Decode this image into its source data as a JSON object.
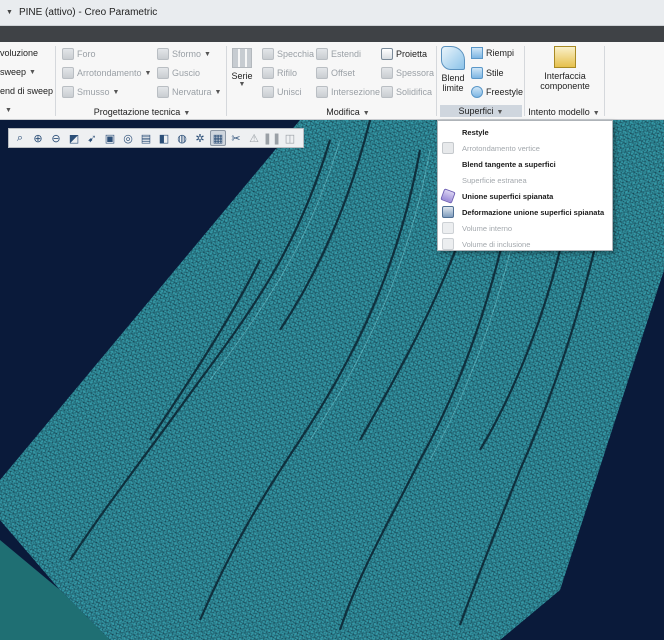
{
  "window": {
    "title": "PINE (attivo) - Creo Parametric"
  },
  "ribbon": {
    "col1": [
      {
        "label": "voluzione"
      },
      {
        "label": "sweep"
      },
      {
        "label": "end di sweep"
      }
    ],
    "engineering": {
      "items": [
        {
          "label": "Foro"
        },
        {
          "label": "Arrotondamento"
        },
        {
          "label": "Smusso"
        },
        {
          "label": "Sformo"
        },
        {
          "label": "Guscio"
        },
        {
          "label": "Nervatura"
        }
      ],
      "group_label": "Progettazione tecnica"
    },
    "edit": {
      "serie_label": "Serie",
      "items": [
        {
          "label": "Specchia"
        },
        {
          "label": "Rifilo"
        },
        {
          "label": "Unisci"
        },
        {
          "label": "Estendi"
        },
        {
          "label": "Offset"
        },
        {
          "label": "Intersezione"
        },
        {
          "label": "Proietta"
        },
        {
          "label": "Spessora"
        },
        {
          "label": "Solidifica"
        }
      ],
      "group_label": "Modifica"
    },
    "surfaces": {
      "blend_line1": "Blend",
      "blend_line2": "limite",
      "items": [
        {
          "label": "Riempi"
        },
        {
          "label": "Stile"
        },
        {
          "label": "Freestyle"
        }
      ],
      "group_label": "Superfici"
    },
    "model_intent": {
      "button_line1": "Interfaccia",
      "button_line2": "componente",
      "group_label": "Intento modello"
    }
  },
  "surfaces_menu": {
    "items": [
      {
        "label": "Restyle",
        "enabled": true
      },
      {
        "label": "Arrotondamento vertice",
        "enabled": false
      },
      {
        "label": "Blend tangente a superfici",
        "enabled": true
      },
      {
        "label": "Superficie estranea",
        "enabled": false
      },
      {
        "label": "Unione superfici spianata",
        "enabled": true
      },
      {
        "label": "Deformazione unione superfici spianata",
        "enabled": true
      },
      {
        "label": "Volume interno",
        "enabled": false
      },
      {
        "label": "Volume di inclusione",
        "enabled": false
      }
    ]
  },
  "view_toolbar": {
    "buttons": [
      {
        "icon": "refit-icon"
      },
      {
        "icon": "zoom-in-icon"
      },
      {
        "icon": "zoom-out-icon"
      },
      {
        "icon": "repaint-icon"
      },
      {
        "icon": "perspective-icon"
      },
      {
        "icon": "display-style-icon"
      },
      {
        "icon": "saved-orientations-icon"
      },
      {
        "icon": "view-manager-icon"
      },
      {
        "icon": "section-icon"
      },
      {
        "icon": "appearance-icon"
      },
      {
        "icon": "datum-display-icon"
      },
      {
        "icon": "mesh-display-icon"
      },
      {
        "icon": "cut-icon"
      },
      {
        "icon": "warning-icon"
      },
      {
        "icon": "pause-icon"
      },
      {
        "icon": "annotation-icon"
      }
    ]
  },
  "colors": {
    "viewport_bg": "#0a1a3a",
    "mesh": "#4ab8c4",
    "mesh_dark": "#1b3f4c",
    "ribbon_bg": "#f7f7f7"
  }
}
